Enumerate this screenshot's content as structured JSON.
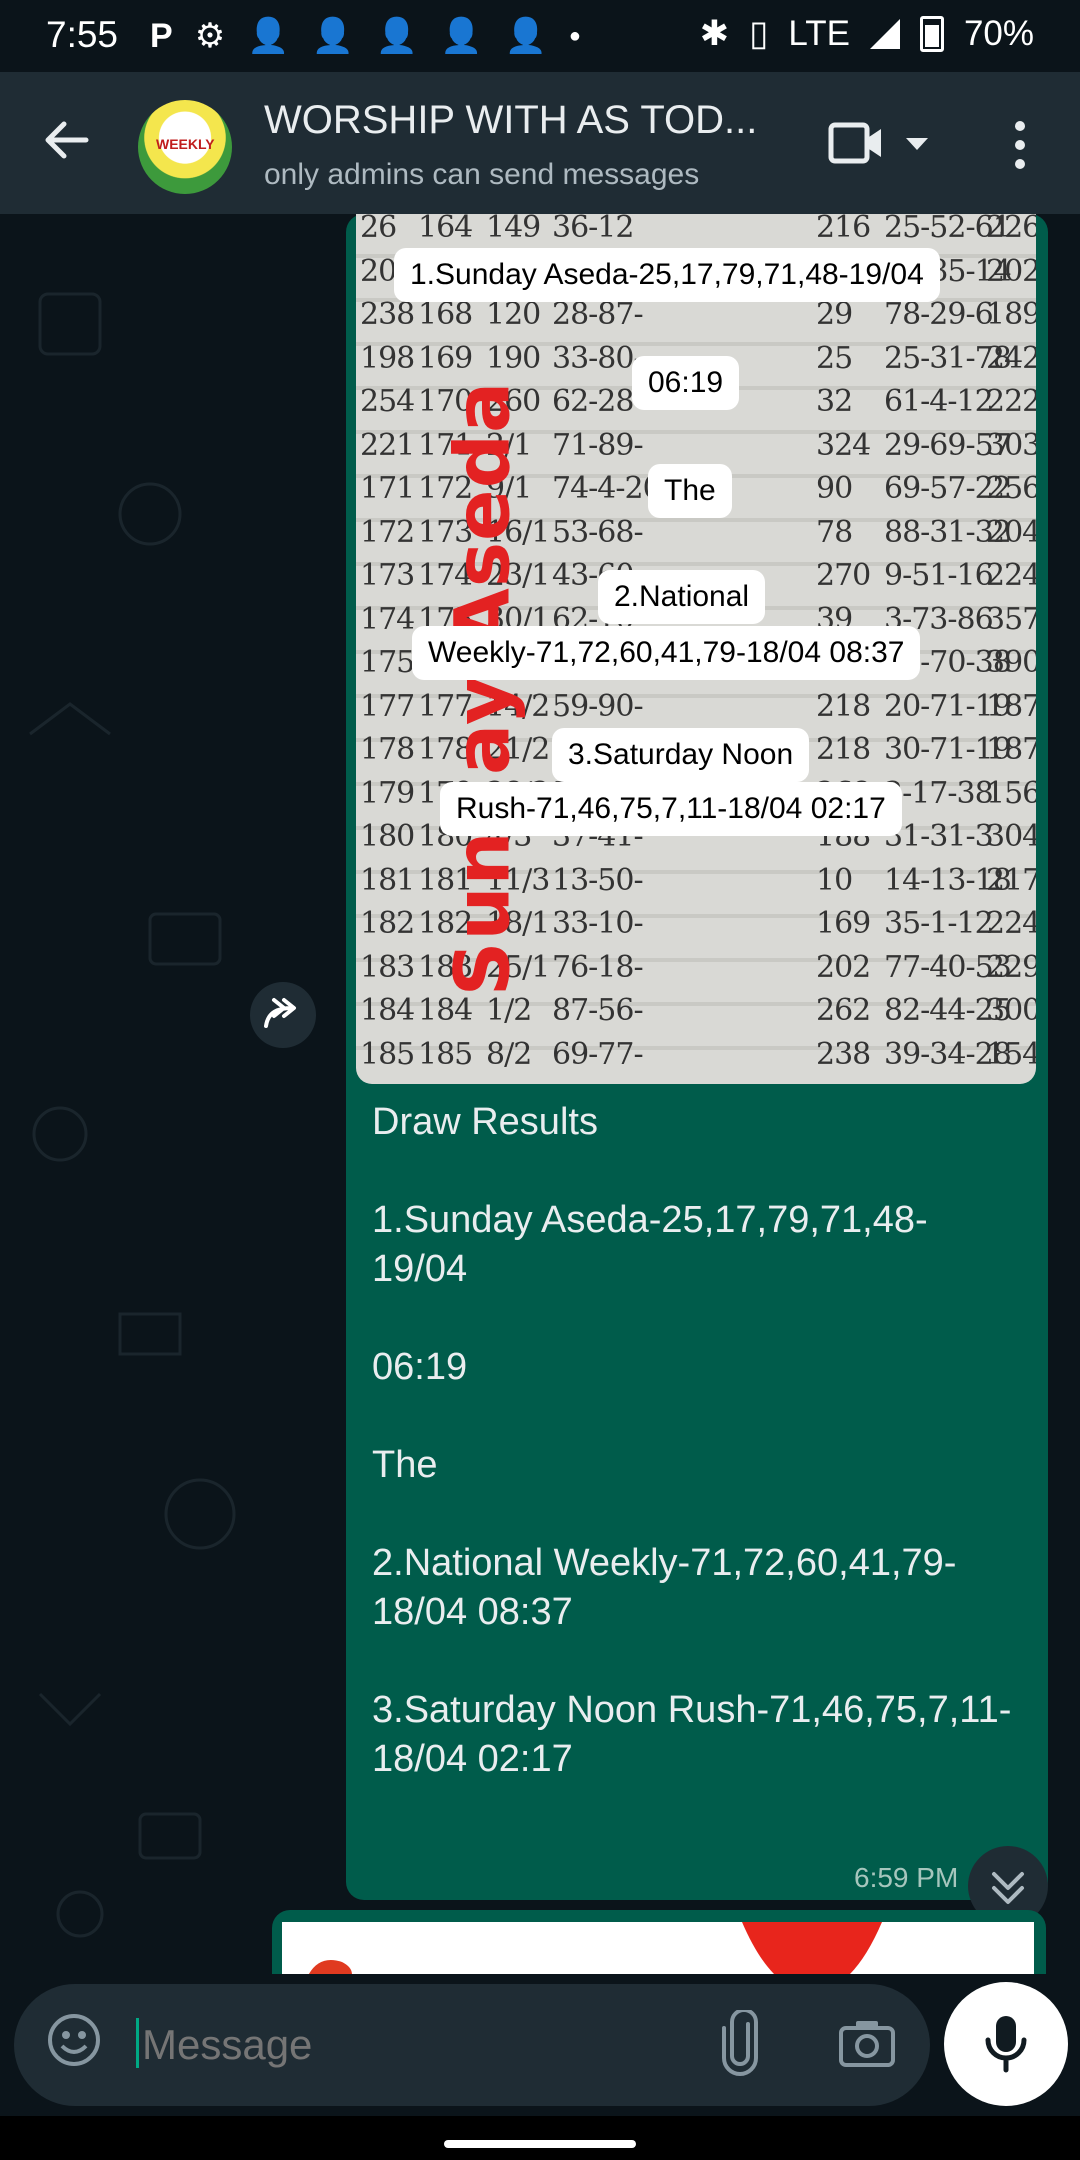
{
  "status_bar": {
    "time": "7:55",
    "left_icons": [
      "p-icon",
      "gear-icon",
      "person-add-icon",
      "person-add-icon",
      "person-add-icon",
      "person-add-icon",
      "person-add-icon",
      "dot-icon"
    ],
    "network": "LTE",
    "battery": "70%"
  },
  "header": {
    "title": "WORSHIP WITH AS TOD...",
    "subtitle": "only admins can send messages"
  },
  "message": {
    "media_caption_vertical": "Sunday Aseda",
    "media_labels": [
      "1.Sunday Aseda-25,17,79,71,48-19/04",
      "06:19",
      "The",
      "2.National",
      "Weekly-71,72,60,41,79-18/04 08:37",
      "3.Saturday Noon",
      "Rush-71,46,75,7,11-18/04 02:17"
    ],
    "text_paragraphs": [
      "Draw Results",
      "1.Sunday Aseda-25,17,79,71,48-19/04",
      "06:19",
      "The",
      "2.National Weekly-71,72,60,41,79-18/04 08:37",
      "3.Saturday Noon Rush-71,46,75,7,11-18/04 02:17"
    ],
    "time": "6:59 PM"
  },
  "composer": {
    "placeholder": "Message"
  },
  "colors": {
    "background": "#0b141a",
    "header": "#1f2c34",
    "outgoing_bubble": "#005c4b",
    "accent": "#00a884"
  }
}
